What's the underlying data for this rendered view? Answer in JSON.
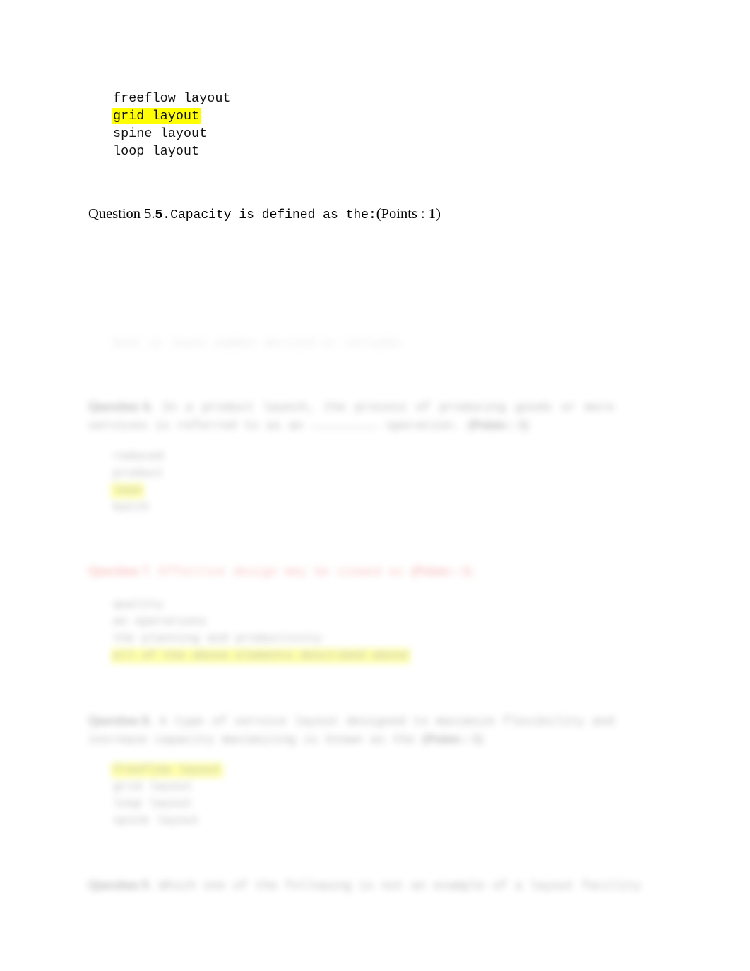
{
  "document": {
    "type": "exam-answer-sheet",
    "background_color": "#ffffff",
    "highlight_color": "#ffff00",
    "red_text_color": "#e8453c"
  },
  "top_options": [
    {
      "text": "freeflow layout",
      "highlighted": false
    },
    {
      "text": "grid layout",
      "highlighted": true
    },
    {
      "text": "spine layout",
      "highlighted": false
    },
    {
      "text": "loop layout",
      "highlighted": false
    }
  ],
  "question5": {
    "lead": "Question 5.",
    "number": "5.",
    "text": "Capacity is defined as the:",
    "points": "(Points : 1)",
    "answer_line": "best or least number dervied or includes"
  },
  "question6": {
    "label": "Question 6.",
    "number": "6.",
    "text_part1": "In a product launch, the process of producing goods or more services is referred to as an",
    "blank": "",
    "text_part2": "operation.",
    "points": "(Points : 1)",
    "options": [
      {
        "text": "reduced",
        "highlighted": false
      },
      {
        "text": "product",
        "highlighted": false
      },
      {
        "text": "lean",
        "highlighted": true
      },
      {
        "text": "batch",
        "highlighted": false
      }
    ]
  },
  "question7": {
    "label": "Question 7.",
    "number": "7.",
    "text": "Effective design may be viewed as",
    "points": "(Points : 1)",
    "options": [
      {
        "text": "quality",
        "highlighted": false
      },
      {
        "text": "an operations",
        "highlighted": false
      },
      {
        "text": "the planning and productivity",
        "highlighted": false
      },
      {
        "text": "all of the above elements described above",
        "highlighted": true
      }
    ]
  },
  "question8": {
    "label": "Question 8.",
    "number": "8.",
    "text_part1": "A type of service layout designed to maximize flexibility and increase capacity",
    "text_part2": "maximizing is known as the",
    "points": "(Points : 1)",
    "options": [
      {
        "text": "freeflow layout",
        "highlighted": true
      },
      {
        "text": "grid layout",
        "highlighted": false
      },
      {
        "text": "loop layout",
        "highlighted": false
      },
      {
        "text": "spine layout",
        "highlighted": false
      }
    ]
  },
  "question9": {
    "label": "Question 9.",
    "number": "9.",
    "text": "Which one of the following is not an example of a layout facility"
  }
}
